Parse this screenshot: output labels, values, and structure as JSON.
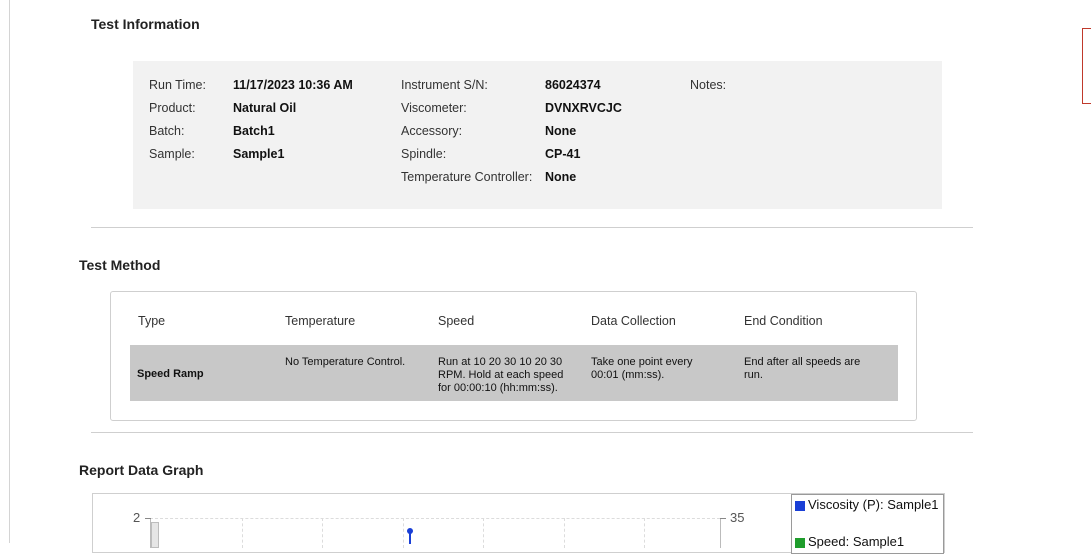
{
  "test_information": {
    "title": "Test Information",
    "col1": [
      {
        "label": "Run Time:",
        "value": "11/17/2023 10:36 AM"
      },
      {
        "label": "Product:",
        "value": "Natural Oil"
      },
      {
        "label": "Batch:",
        "value": "Batch1"
      },
      {
        "label": "Sample:",
        "value": "Sample1"
      }
    ],
    "col2": [
      {
        "label": "Instrument S/N:",
        "value": "86024374"
      },
      {
        "label": "Viscometer:",
        "value": "DVNXRVCJC"
      },
      {
        "label": "Accessory:",
        "value": "None"
      },
      {
        "label": "Spindle:",
        "value": "CP-41"
      },
      {
        "label": "Temperature Controller:",
        "value": "None"
      }
    ],
    "notes_label": "Notes:"
  },
  "test_method": {
    "title": "Test Method",
    "headers": [
      "Type",
      "Temperature",
      "Speed",
      "Data Collection",
      "End Condition"
    ],
    "row": {
      "type": "Speed Ramp",
      "temperature": "No Temperature Control.",
      "speed": [
        "Run at 10 20 30 10 20 30",
        "RPM. Hold at each speed",
        "for 00:00:10 (hh:mm:ss)."
      ],
      "data_collection": [
        "Take one point every",
        "00:01 (mm:ss)."
      ],
      "end_condition": [
        "End after all speeds are",
        "run."
      ]
    }
  },
  "report_graph": {
    "title": "Report Data Graph",
    "left_axis_top": "2",
    "right_axis_top": "35",
    "legend": [
      {
        "label": "Viscosity (P): Sample1",
        "color": "#1a3fd6"
      },
      {
        "label": "Speed: Sample1",
        "color": "#1f9d2c"
      }
    ]
  }
}
